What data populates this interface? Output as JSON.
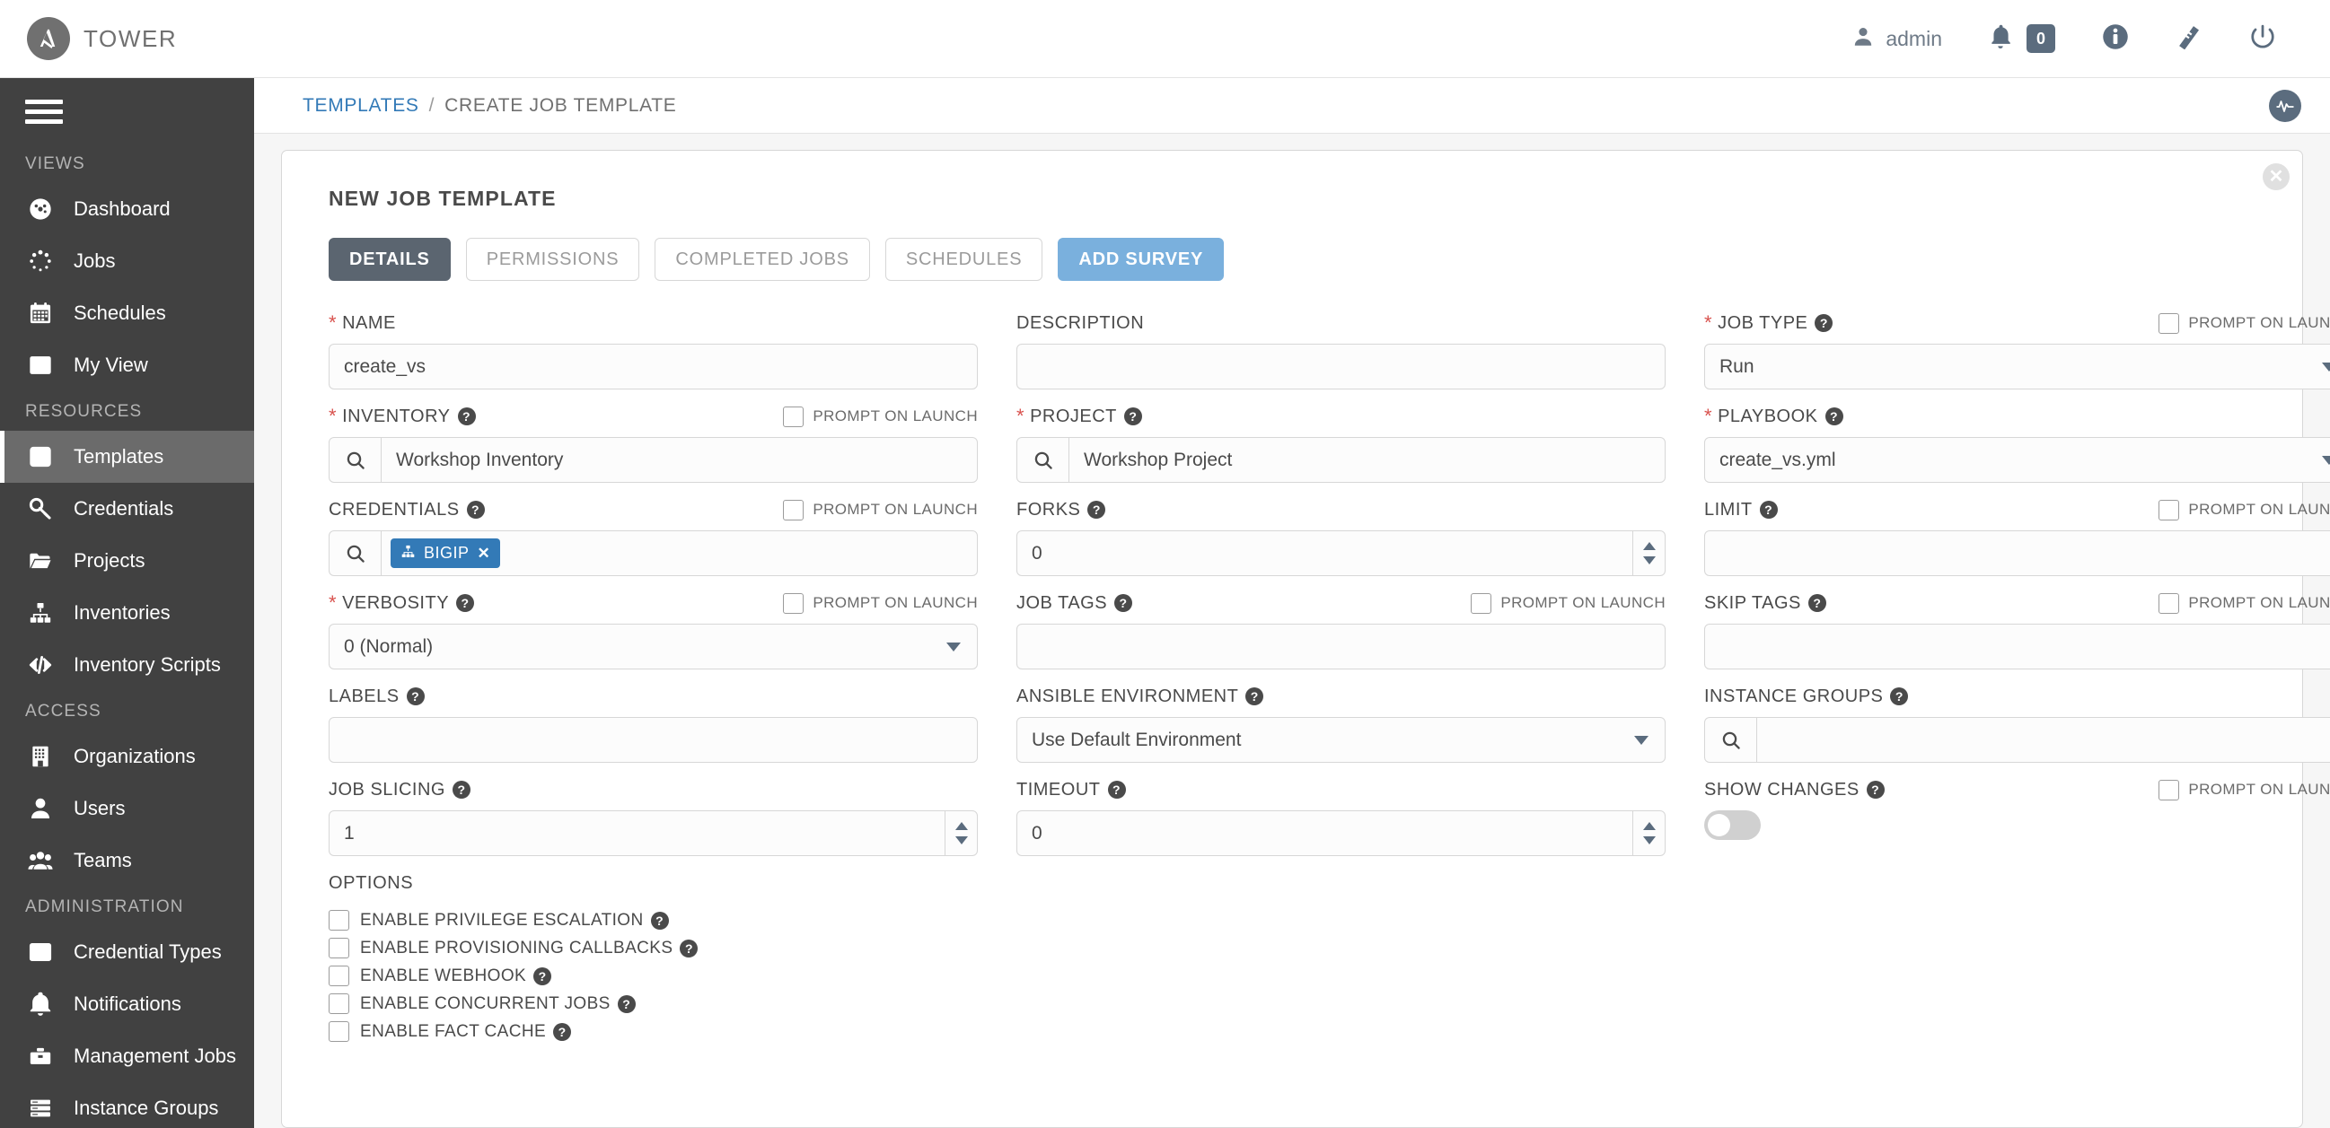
{
  "app": {
    "brand_name": "TOWER",
    "logo_icon": "ansible-logo-icon"
  },
  "topnav": {
    "user_icon": "user-icon",
    "user_label": "admin",
    "bell_icon": "bell-icon",
    "notification_count": "0",
    "info_icon": "info-circle-icon",
    "docs_icon": "book-icon",
    "logout_icon": "power-icon"
  },
  "sidebar": {
    "menu_icon": "hamburger-menu-icon",
    "sections": [
      {
        "title": "VIEWS",
        "items": [
          {
            "label": "Dashboard",
            "icon": "dashboard-icon",
            "active": false
          },
          {
            "label": "Jobs",
            "icon": "jobs-spinner-icon",
            "active": false
          },
          {
            "label": "Schedules",
            "icon": "calendar-icon",
            "active": false
          },
          {
            "label": "My View",
            "icon": "columns-icon",
            "active": false
          }
        ]
      },
      {
        "title": "RESOURCES",
        "items": [
          {
            "label": "Templates",
            "icon": "template-pencil-icon",
            "active": true
          },
          {
            "label": "Credentials",
            "icon": "key-icon",
            "active": false
          },
          {
            "label": "Projects",
            "icon": "folder-icon",
            "active": false
          },
          {
            "label": "Inventories",
            "icon": "sitemap-icon",
            "active": false
          },
          {
            "label": "Inventory Scripts",
            "icon": "code-icon",
            "active": false
          }
        ]
      },
      {
        "title": "ACCESS",
        "items": [
          {
            "label": "Organizations",
            "icon": "building-icon",
            "active": false
          },
          {
            "label": "Users",
            "icon": "user-icon",
            "active": false
          },
          {
            "label": "Teams",
            "icon": "users-group-icon",
            "active": false
          }
        ]
      },
      {
        "title": "ADMINISTRATION",
        "items": [
          {
            "label": "Credential Types",
            "icon": "list-icon",
            "active": false
          },
          {
            "label": "Notifications",
            "icon": "bell-icon",
            "active": false
          },
          {
            "label": "Management Jobs",
            "icon": "briefcase-icon",
            "active": false
          },
          {
            "label": "Instance Groups",
            "icon": "server-stack-icon",
            "active": false
          }
        ]
      }
    ]
  },
  "breadcrumb": {
    "parent": "TEMPLATES",
    "separator": "/",
    "current": "CREATE JOB TEMPLATE",
    "activity_icon": "activity-stream-icon"
  },
  "card": {
    "title": "NEW JOB TEMPLATE",
    "close_icon": "close-circle-icon",
    "tabs": [
      {
        "label": "DETAILS",
        "state": "active"
      },
      {
        "label": "PERMISSIONS",
        "state": "default"
      },
      {
        "label": "COMPLETED JOBS",
        "state": "default"
      },
      {
        "label": "SCHEDULES",
        "state": "default"
      },
      {
        "label": "ADD SURVEY",
        "state": "primary"
      }
    ]
  },
  "prompt_on_launch_label": "PROMPT ON LAUNCH",
  "form": {
    "name": {
      "label": "NAME",
      "value": "create_vs",
      "required": true
    },
    "description": {
      "label": "DESCRIPTION",
      "value": "",
      "required": false
    },
    "job_type": {
      "label": "JOB TYPE",
      "value": "Run",
      "required": true,
      "prompt_on_launch": false
    },
    "inventory": {
      "label": "INVENTORY",
      "value": "Workshop Inventory",
      "required": true,
      "prompt_on_launch": false
    },
    "project": {
      "label": "PROJECT",
      "value": "Workshop Project",
      "required": true
    },
    "playbook": {
      "label": "PLAYBOOK",
      "value": "create_vs.yml",
      "required": true
    },
    "credentials": {
      "label": "CREDENTIALS",
      "required": false,
      "prompt_on_launch": false,
      "chips": [
        {
          "label": "BIGIP",
          "icon": "sitemap-icon",
          "remove_icon": "x-icon"
        }
      ]
    },
    "forks": {
      "label": "FORKS",
      "value": "0"
    },
    "limit": {
      "label": "LIMIT",
      "value": "",
      "prompt_on_launch": false
    },
    "verbosity": {
      "label": "VERBOSITY",
      "value": "0 (Normal)",
      "required": true,
      "prompt_on_launch": false
    },
    "job_tags": {
      "label": "JOB TAGS",
      "value": "",
      "prompt_on_launch": false
    },
    "skip_tags": {
      "label": "SKIP TAGS",
      "value": "",
      "prompt_on_launch": false
    },
    "labels": {
      "label": "LABELS",
      "value": ""
    },
    "ansible_environment": {
      "label": "ANSIBLE ENVIRONMENT",
      "value": "Use Default Environment"
    },
    "instance_groups": {
      "label": "INSTANCE GROUPS",
      "value": ""
    },
    "job_slicing": {
      "label": "JOB SLICING",
      "value": "1"
    },
    "timeout": {
      "label": "TIMEOUT",
      "value": "0"
    },
    "show_changes": {
      "label": "SHOW CHANGES",
      "toggle_on": false,
      "prompt_on_launch": false
    }
  },
  "options": {
    "title": "OPTIONS",
    "items": [
      {
        "label": "ENABLE PRIVILEGE ESCALATION",
        "checked": false
      },
      {
        "label": "ENABLE PROVISIONING CALLBACKS",
        "checked": false
      },
      {
        "label": "ENABLE WEBHOOK",
        "checked": false
      },
      {
        "label": "ENABLE CONCURRENT JOBS",
        "checked": false
      },
      {
        "label": "ENABLE FACT CACHE",
        "checked": false
      }
    ]
  },
  "colors": {
    "accent_blue": "#337ab7",
    "primary_button": "#7ab0dd",
    "sidebar_bg": "#414141",
    "sidebar_active": "#6b6b6b",
    "required_red": "#d9534f",
    "tab_active": "#5b6570"
  }
}
